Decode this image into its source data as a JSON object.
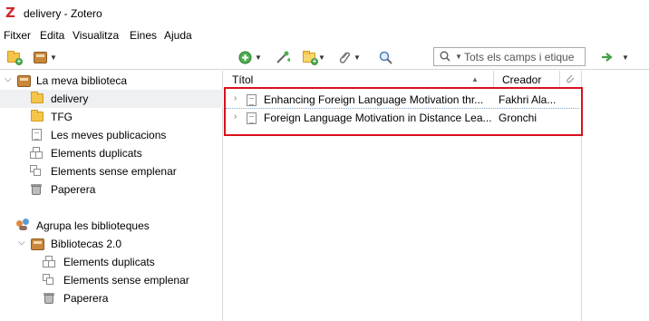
{
  "window": {
    "title": "delivery - Zotero",
    "logo_icon": "zotero-z-icon",
    "logo_text": "Z",
    "logo_color": "#d02828"
  },
  "menu": [
    {
      "label": "Fitxer"
    },
    {
      "label": "Edita"
    },
    {
      "label": "Visualitza"
    },
    {
      "label": "Eines"
    },
    {
      "label": "Ajuda"
    }
  ],
  "toolbar": {
    "new_collection_icon": "new-collection-icon",
    "new_library_icon": "new-library-icon",
    "new_item_icon": "new-item-icon",
    "add_by_identifier_icon": "magic-wand-icon",
    "new_note_icon": "new-note-icon",
    "attachment_icon": "paperclip-icon",
    "advanced_search_icon": "magnifier-icon",
    "locate_icon": "green-arrow-icon",
    "search_placeholder": "Tots els camps i etique"
  },
  "sidebar": {
    "my_library": {
      "label": "La meva biblioteca",
      "items": [
        {
          "label": "delivery",
          "icon": "folder-icon",
          "selected": true
        },
        {
          "label": "TFG",
          "icon": "folder-icon"
        },
        {
          "label": "Les meves publicacions",
          "icon": "document-icon"
        },
        {
          "label": "Elements duplicats",
          "icon": "duplicate-icon"
        },
        {
          "label": "Elements sense emplenar",
          "icon": "unfiled-icon"
        },
        {
          "label": "Paperera",
          "icon": "trash-icon"
        }
      ]
    },
    "groups": {
      "label": "Agrupa les biblioteques",
      "library": {
        "label": "Bibliotecas 2.0",
        "items": [
          {
            "label": "Elements duplicats",
            "icon": "duplicate-icon"
          },
          {
            "label": "Elements sense emplenar",
            "icon": "unfiled-icon"
          },
          {
            "label": "Paperera",
            "icon": "trash-icon"
          }
        ]
      }
    }
  },
  "items_table": {
    "columns": [
      {
        "label": "Títol"
      },
      {
        "label": "Creador"
      }
    ],
    "sort_indicator": "▲",
    "rows": [
      {
        "title": "Enhancing Foreign Language Motivation thr...",
        "creator": "Fakhri Ala..."
      },
      {
        "title": "Foreign Language Motivation in Distance Lea...",
        "creator": "Gronchi"
      }
    ]
  },
  "colors": {
    "highlight_box": "#d8121d",
    "selection": "#eef0f2",
    "folder": "#f5c54a"
  }
}
